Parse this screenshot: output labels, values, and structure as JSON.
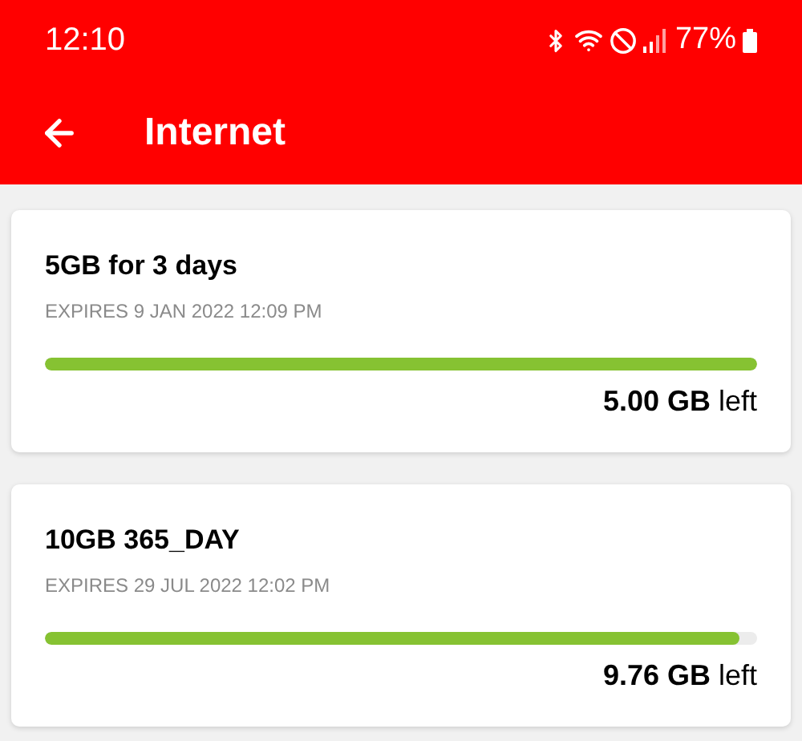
{
  "status_bar": {
    "time": "12:10",
    "battery": "77%"
  },
  "app_bar": {
    "title": "Internet"
  },
  "plans": [
    {
      "name": "5GB for 3 days",
      "expiry": "EXPIRES 9 JAN 2022 12:09 PM",
      "level": 1.0,
      "remaining": "**5.00 GB** left"
    },
    {
      "name": "10GB 365_DAY",
      "expiry": "EXPIRES 29 JUL 2022 12:02 PM",
      "level": 0.976,
      "remaining": "**9.76 GB** left"
    }
  ]
}
